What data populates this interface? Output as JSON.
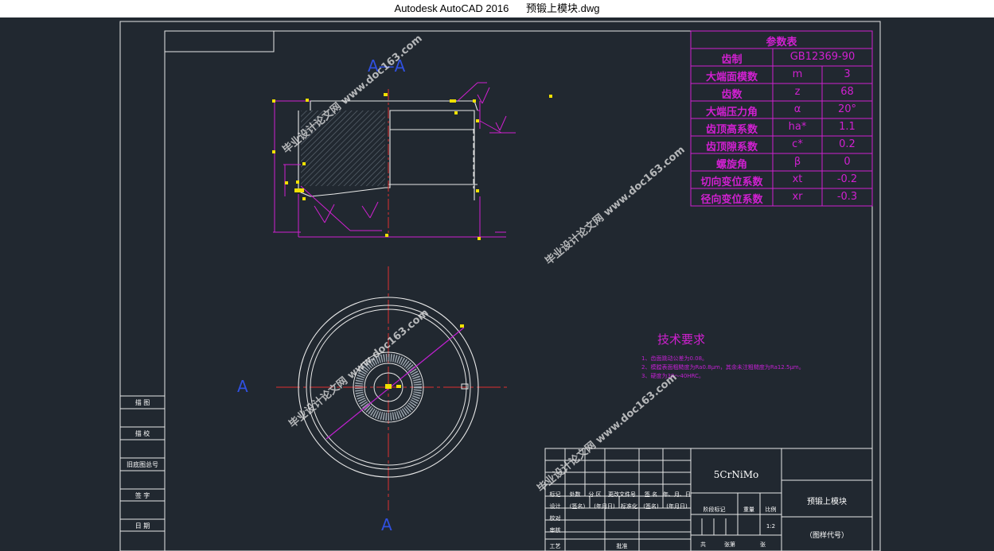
{
  "window": {
    "app": "Autodesk AutoCAD 2016",
    "file": "预锻上模块.dwg"
  },
  "drawing": {
    "section_label": "A—A",
    "cut_a_left": "A",
    "cut_a_bottom": "A",
    "tech_title": "技术要求",
    "tech_items": [
      "1、齿面跳动公差为0.08。",
      "2、模膛表面粗糙度为Ra0.8μm，其余未注粗糙度为Ra12.5μm。",
      "3、硬度为38～40HRC。"
    ],
    "watermarks": [
      "毕业设计论文网 www.doc163.com",
      "毕业设计论文网 www.doc163.com",
      "毕业设计论文网 www.doc163.com",
      "毕业设计论文网 www.doc163.com"
    ]
  },
  "param_table": {
    "title": "参数表",
    "rows": [
      {
        "name": "齿制",
        "sym": "",
        "val": "GB12369-90"
      },
      {
        "name": "大端面模数",
        "sym": "m",
        "val": "3"
      },
      {
        "name": "齿数",
        "sym": "z",
        "val": "68"
      },
      {
        "name": "大端压力角",
        "sym": "α",
        "val": "20°"
      },
      {
        "name": "齿顶高系数",
        "sym": "ha*",
        "val": "1.1"
      },
      {
        "name": "齿顶隙系数",
        "sym": "c*",
        "val": "0.2"
      },
      {
        "name": "螺旋角",
        "sym": "β",
        "val": "0"
      },
      {
        "name": "切向变位系数",
        "sym": "xt",
        "val": "-0.2"
      },
      {
        "name": "径向变位系数",
        "sym": "xr",
        "val": "-0.3"
      }
    ]
  },
  "side_block": [
    "描 图",
    "描 校",
    "旧底图总号",
    "签 字",
    "日 期"
  ],
  "title_block": {
    "material": "5CrNiMo",
    "part_name": "预锻上模块",
    "drawing_code": "（图样代号）",
    "header_row": [
      "标记",
      "处数",
      "分 区",
      "更改文件号",
      "签 名",
      "年、月、日"
    ],
    "row_design": [
      "设计",
      "(签名)",
      "(年月日)",
      "标准化",
      "(签名)",
      "(年月日)"
    ],
    "stage_labels": [
      "阶段标记",
      "重量",
      "比例"
    ],
    "scale": "1:2",
    "left_rows": [
      "校对",
      "审核",
      "工艺"
    ],
    "approve": "批准",
    "sheet_info": [
      "共",
      "张第",
      "张"
    ]
  }
}
